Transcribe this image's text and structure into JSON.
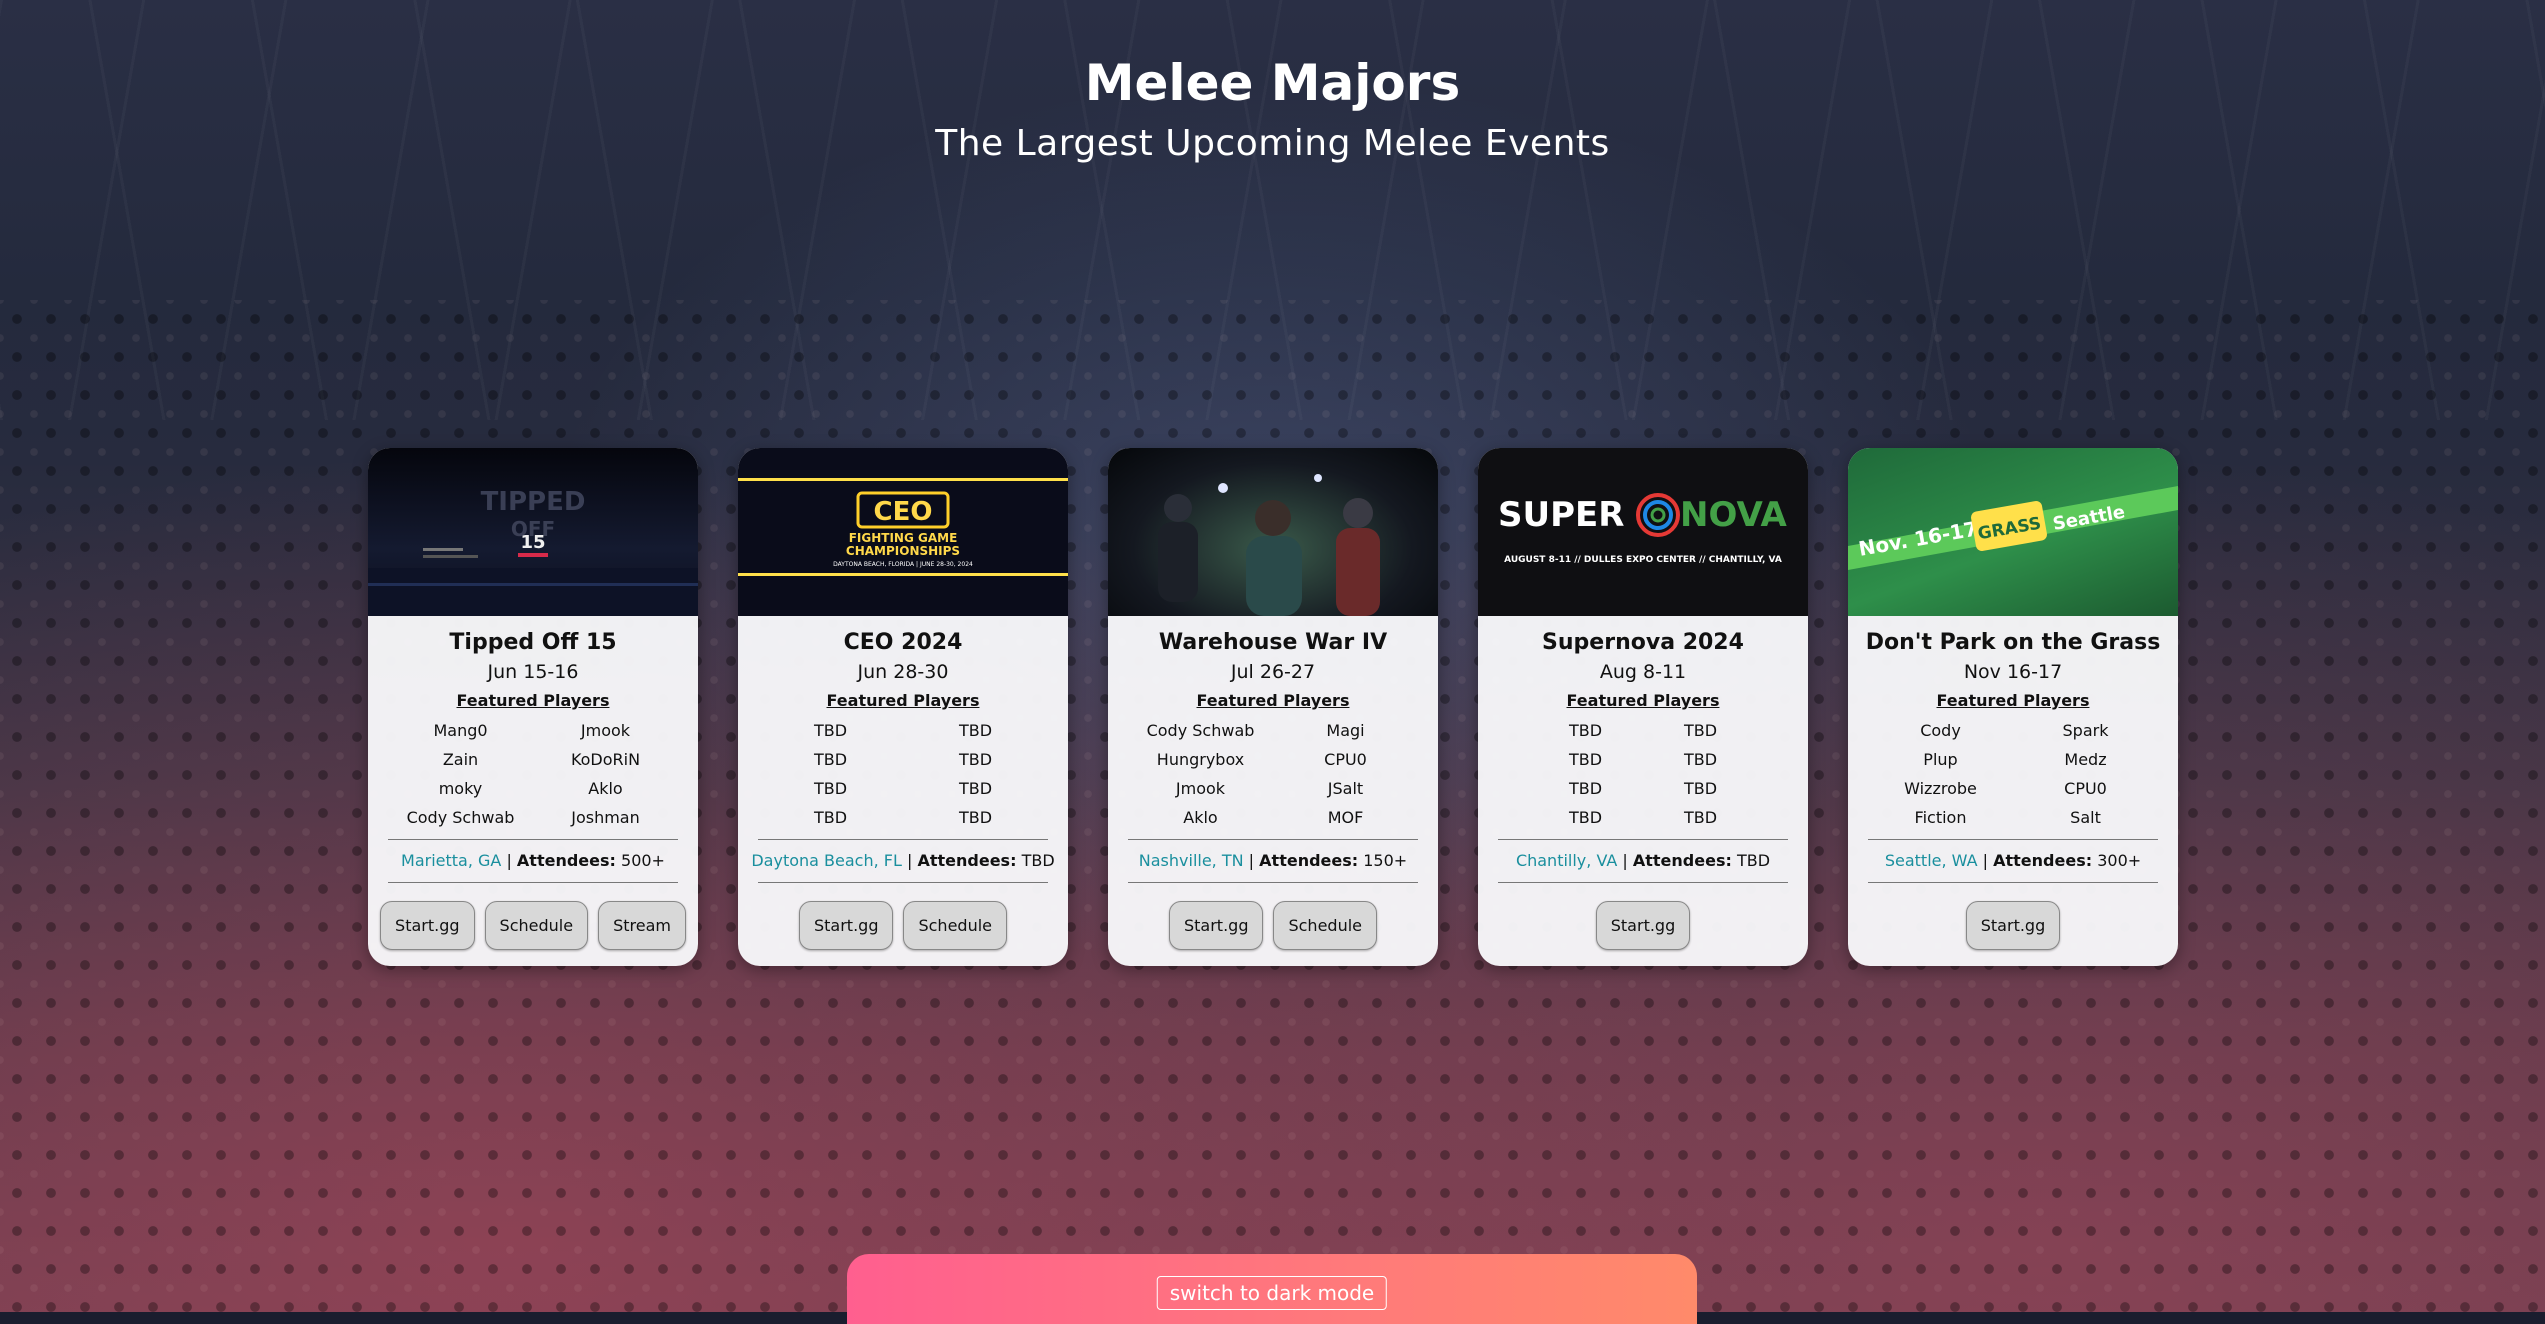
{
  "header": {
    "title": "Melee Majors",
    "subtitle": "The Largest Upcoming Melee Events"
  },
  "events": [
    {
      "name": "Tipped Off 15",
      "date": "Jun 15-16",
      "featured_label": "Featured Players",
      "players": [
        "Mang0",
        "Jmook",
        "Zain",
        "KoDoRiN",
        "moky",
        "Aklo",
        "Cody Schwab",
        "Joshman"
      ],
      "location": "Marietta, GA",
      "attendees_label": "Attendees:",
      "attendees": "500+",
      "buttons": [
        "Start.gg",
        "Schedule",
        "Stream"
      ]
    },
    {
      "name": "CEO 2024",
      "date": "Jun 28-30",
      "featured_label": "Featured Players",
      "players": [
        "TBD",
        "TBD",
        "TBD",
        "TBD",
        "TBD",
        "TBD",
        "TBD",
        "TBD"
      ],
      "location": "Daytona Beach, FL",
      "attendees_label": "Attendees:",
      "attendees": "TBD",
      "buttons": [
        "Start.gg",
        "Schedule"
      ],
      "banner": {
        "logo": "CEO",
        "line1": "FIGHTING GAME",
        "line2": "CHAMPIONSHIPS",
        "line3": "DAYTONA BEACH, FLORIDA | JUNE 28-30, 2024"
      }
    },
    {
      "name": "Warehouse War IV",
      "date": "Jul 26-27",
      "featured_label": "Featured Players",
      "players": [
        "Cody Schwab",
        "Magi",
        "Hungrybox",
        "CPU0",
        "Jmook",
        "JSalt",
        "Aklo",
        "MOF"
      ],
      "location": "Nashville, TN",
      "attendees_label": "Attendees:",
      "attendees": "150+",
      "buttons": [
        "Start.gg",
        "Schedule"
      ]
    },
    {
      "name": "Supernova 2024",
      "date": "Aug 8-11",
      "featured_label": "Featured Players",
      "players": [
        "TBD",
        "TBD",
        "TBD",
        "TBD",
        "TBD",
        "TBD",
        "TBD",
        "TBD"
      ],
      "location": "Chantilly, VA",
      "attendees_label": "Attendees:",
      "attendees": "TBD",
      "buttons": [
        "Start.gg"
      ],
      "banner": {
        "logo_left": "SUPER",
        "logo_right": "NOVA",
        "line1": "AUGUST 8-11  //  DULLES EXPO CENTER  //  CHANTILLY, VA"
      }
    },
    {
      "name": "Don't Park on the Grass",
      "date": "Nov 16-17",
      "featured_label": "Featured Players",
      "players": [
        "Cody",
        "Spark",
        "Plup",
        "Medz",
        "Wizzrobe",
        "CPU0",
        "Fiction",
        "Salt"
      ],
      "location": "Seattle, WA",
      "attendees_label": "Attendees:",
      "attendees": "300+",
      "buttons": [
        "Start.gg"
      ],
      "banner": {
        "dates": "Nov. 16-17",
        "logo": "GRASS",
        "city": "Seattle"
      }
    }
  ],
  "footer": {
    "dark_mode_label": "switch to dark mode"
  },
  "colors": {
    "location_link": "#1a8f9e",
    "footer_gradient_start": "#ff5f8f",
    "footer_gradient_end": "#ff8a6a"
  }
}
